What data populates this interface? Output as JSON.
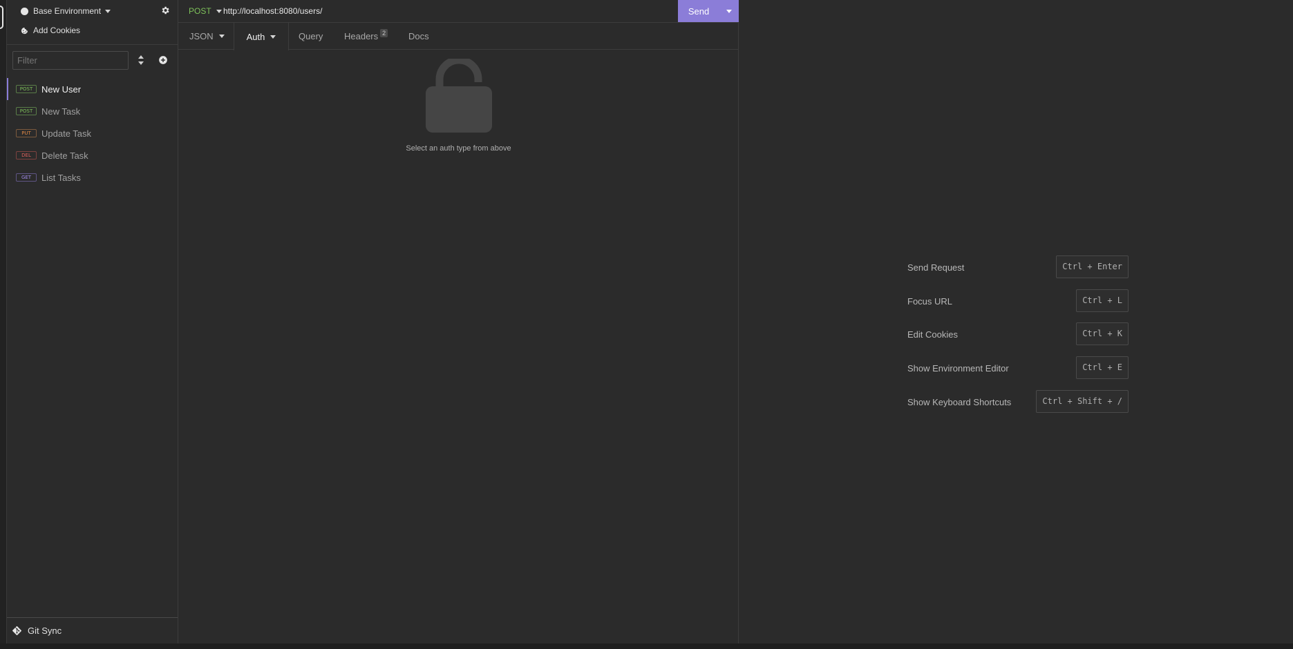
{
  "sidebar": {
    "environment_label": "Base Environment",
    "cookies_label": "Add Cookies",
    "filter_placeholder": "Filter",
    "requests": [
      {
        "method": "POST",
        "name": "New User",
        "active": true
      },
      {
        "method": "POST",
        "name": "New Task",
        "active": false
      },
      {
        "method": "PUT",
        "name": "Update Task",
        "active": false
      },
      {
        "method": "DEL",
        "name": "Delete Task",
        "active": false
      },
      {
        "method": "GET",
        "name": "List Tasks",
        "active": false
      }
    ],
    "git_sync_label": "Git Sync"
  },
  "request": {
    "method": "POST",
    "url": "http://localhost:8080/users/",
    "send_label": "Send",
    "tabs": {
      "body": "JSON",
      "auth": "Auth",
      "query": "Query",
      "headers": "Headers",
      "headers_count": "2",
      "docs": "Docs"
    },
    "auth_hint": "Select an auth type from above"
  },
  "shortcuts": [
    {
      "label": "Send Request",
      "keys": "Ctrl + Enter"
    },
    {
      "label": "Focus URL",
      "keys": "Ctrl + L"
    },
    {
      "label": "Edit Cookies",
      "keys": "Ctrl + K"
    },
    {
      "label": "Show Environment Editor",
      "keys": "Ctrl + E"
    },
    {
      "label": "Show Keyboard Shortcuts",
      "keys": "Ctrl + Shift + /"
    }
  ],
  "colors": {
    "accent": "#8b7dd8",
    "post": "#7ec25a",
    "put": "#e08845",
    "delete": "#e0615c",
    "get": "#a08be8",
    "background": "#2b2b2b"
  }
}
